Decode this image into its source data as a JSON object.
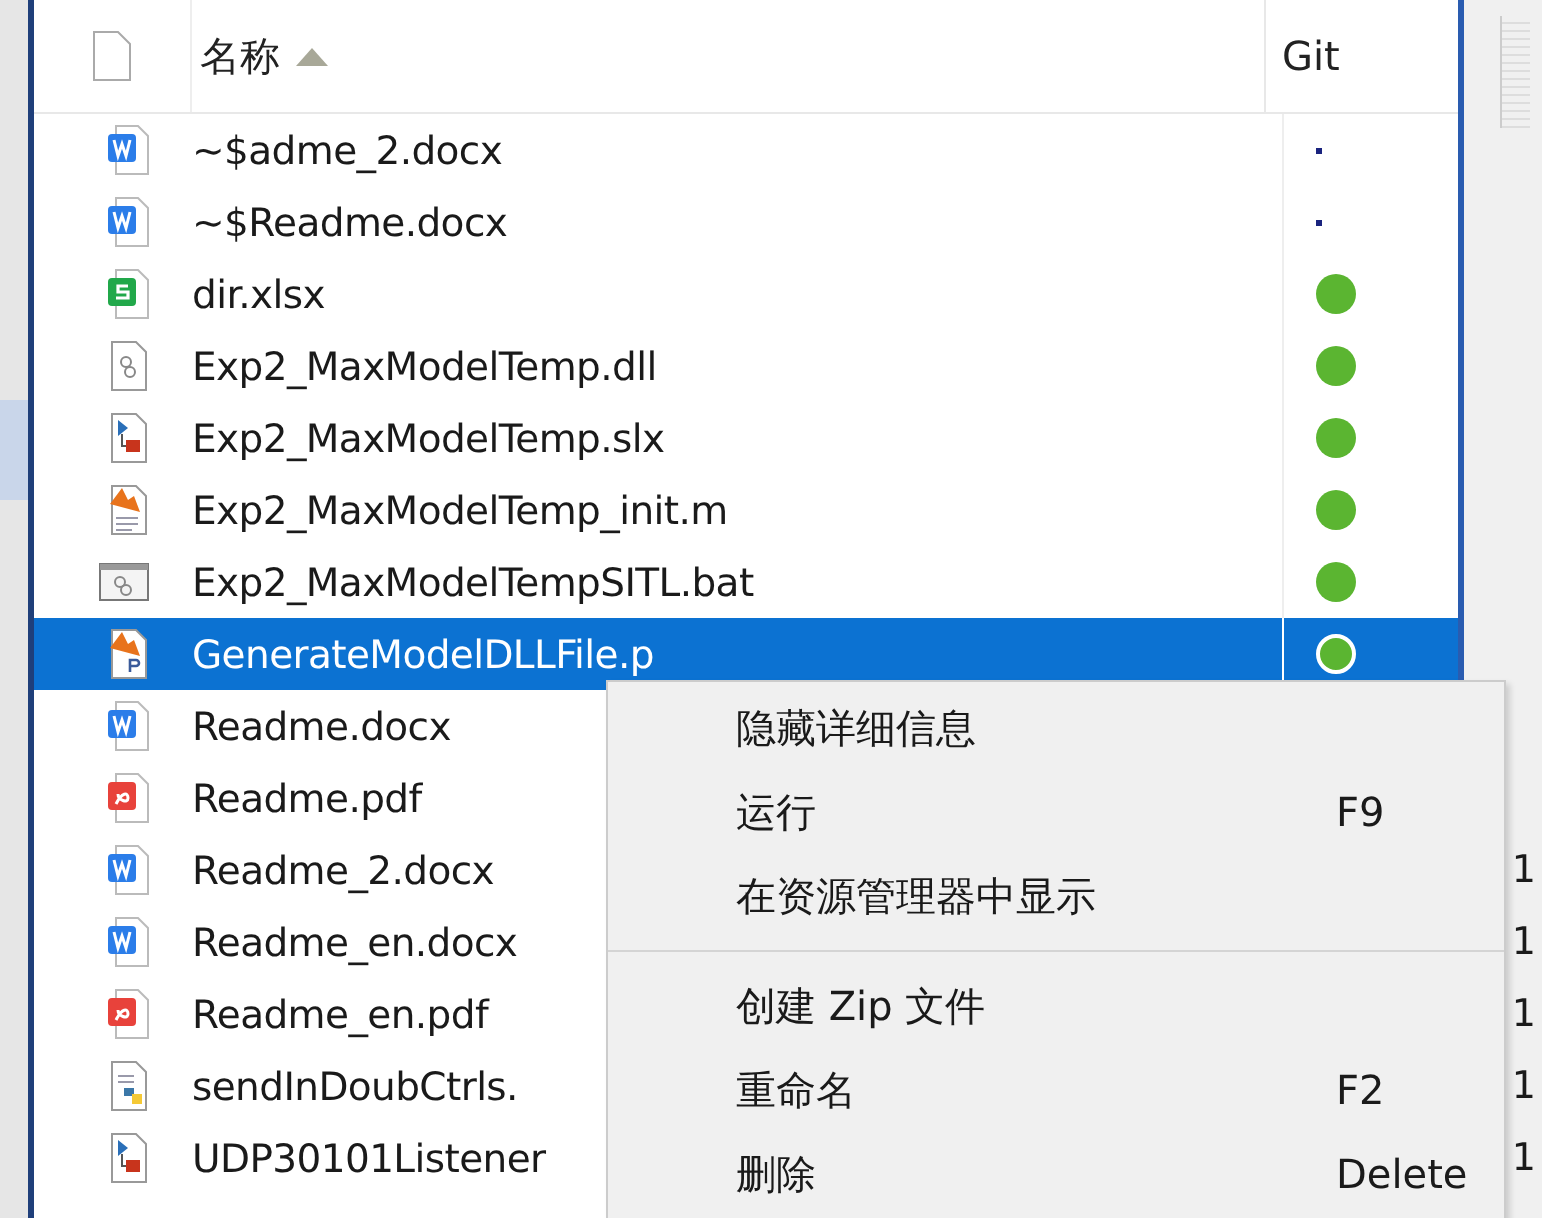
{
  "header": {
    "name_column": "名称",
    "git_column": "Git",
    "sort_ascending": true
  },
  "files": [
    {
      "name": "~$adme_2.docx",
      "kind": "word",
      "git_tracked": false,
      "selected": false
    },
    {
      "name": "~$Readme.docx",
      "kind": "word",
      "git_tracked": false,
      "selected": false
    },
    {
      "name": "dir.xlsx",
      "kind": "sheet",
      "git_tracked": true,
      "selected": false
    },
    {
      "name": "Exp2_MaxModelTemp.dll",
      "kind": "library",
      "git_tracked": true,
      "selected": false
    },
    {
      "name": "Exp2_MaxModelTemp.slx",
      "kind": "model",
      "git_tracked": true,
      "selected": false
    },
    {
      "name": "Exp2_MaxModelTemp_init.m",
      "kind": "script",
      "git_tracked": true,
      "selected": false
    },
    {
      "name": "Exp2_MaxModelTempSITL.bat",
      "kind": "batch",
      "git_tracked": true,
      "selected": false
    },
    {
      "name": "GenerateModelDLLFile.p",
      "kind": "pcode",
      "git_tracked": true,
      "selected": true
    },
    {
      "name": "Readme.docx",
      "kind": "word",
      "selected": false
    },
    {
      "name": "Readme.pdf",
      "kind": "pdf",
      "selected": false
    },
    {
      "name": "Readme_2.docx",
      "kind": "word",
      "selected": false,
      "column_2": "1"
    },
    {
      "name": "Readme_en.docx",
      "kind": "word",
      "selected": false,
      "column_2": "1"
    },
    {
      "name": "Readme_en.pdf",
      "kind": "pdf",
      "selected": false,
      "column_2": "1"
    },
    {
      "name": "sendInDoubCtrls.",
      "kind": "python",
      "selected": false,
      "column_2": "1"
    },
    {
      "name": "UDP30101Listener",
      "kind": "model",
      "selected": false,
      "column_2": "1"
    }
  ],
  "context_menu": [
    {
      "kind": "item",
      "label": "隐藏详细信息"
    },
    {
      "kind": "item",
      "label": "运行",
      "shortcut": "F9"
    },
    {
      "kind": "item",
      "label": "在资源管理器中显示"
    },
    {
      "kind": "separator"
    },
    {
      "kind": "item",
      "label": "创建 Zip 文件"
    },
    {
      "kind": "item",
      "label": "重命名",
      "shortcut": "F2"
    },
    {
      "kind": "item",
      "label": "删除",
      "shortcut": "Delete"
    }
  ]
}
